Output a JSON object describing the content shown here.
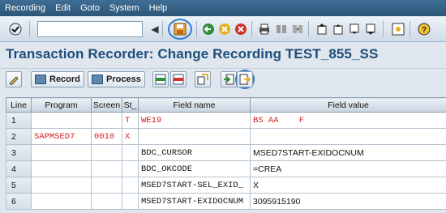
{
  "menu": [
    "Recording",
    "Edit",
    "Goto",
    "System",
    "Help"
  ],
  "command_field": {
    "value": ""
  },
  "toolbar_icons": [
    "enter-check-icon",
    "save-icon",
    "back-icon",
    "exit-icon",
    "cancel-icon",
    "print-icon",
    "find-icon",
    "find-next-icon",
    "first-page-icon",
    "previous-page-icon",
    "next-page-icon",
    "last-page-icon",
    "layout-icon",
    "help-icon"
  ],
  "title": "Transaction Recorder: Change Recording TEST_855_SS",
  "app_toolbar": {
    "record_label": "Record",
    "process_label": "Process"
  },
  "table": {
    "headers": [
      "Line",
      "Program",
      "Screen",
      "St_",
      "Field name",
      "Field value"
    ],
    "rows": [
      {
        "line": "1",
        "program": "",
        "screen": "",
        "st": "T",
        "field": "WE19",
        "value": "BS AA    F"
      },
      {
        "line": "2",
        "program": "SAPMSED7",
        "screen": "0010",
        "st": "X",
        "field": "",
        "value": ""
      },
      {
        "line": "3",
        "program": "",
        "screen": "",
        "st": "",
        "field": "BDC_CURSOR",
        "value": "MSED7START-EXIDOCNUM"
      },
      {
        "line": "4",
        "program": "",
        "screen": "",
        "st": "",
        "field": "BDC_OKCODE",
        "value": "=CREA"
      },
      {
        "line": "5",
        "program": "",
        "screen": "",
        "st": "",
        "field": "MSED7START-SEL_EXID_",
        "value": "X"
      },
      {
        "line": "6",
        "program": "",
        "screen": "",
        "st": "",
        "field": "MSED7START-EXIDOCNUM",
        "value": "3095915190"
      }
    ]
  },
  "colors": {
    "title": "#1f4e7a",
    "menubar": "#2c5677",
    "highlight": "#2f7ad0",
    "red_text": "#d42020"
  }
}
